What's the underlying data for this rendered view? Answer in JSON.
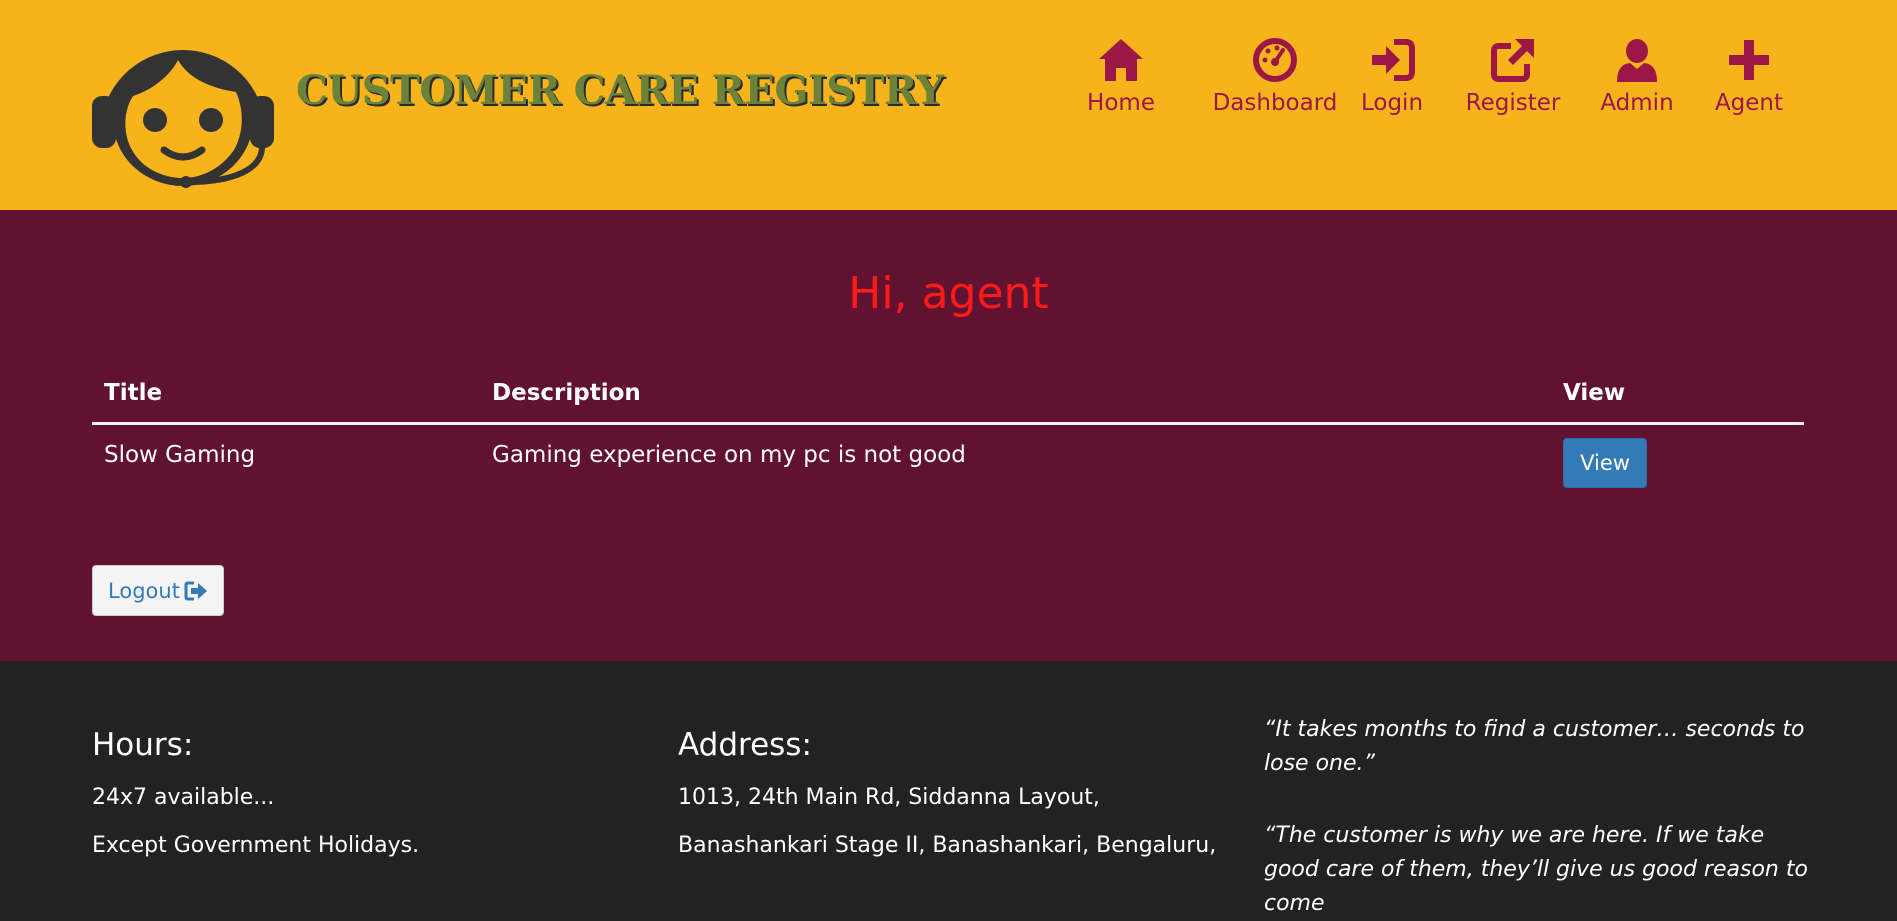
{
  "header": {
    "site_title": "CUSTOMER CARE REGISTRY",
    "logo_icon": "support-agent-headset-face-icon",
    "nav": [
      {
        "label": "Home",
        "icon": "home-icon"
      },
      {
        "label": "Dashboard",
        "icon": "dashboard-icon"
      },
      {
        "label": "Login",
        "icon": "login-icon"
      },
      {
        "label": "Register",
        "icon": "external-link-icon"
      },
      {
        "label": "Admin",
        "icon": "user-icon"
      },
      {
        "label": "Agent",
        "icon": "plus-icon"
      }
    ]
  },
  "main": {
    "greeting": "Hi, agent",
    "table": {
      "columns": [
        "Title",
        "Description",
        "View"
      ],
      "rows": [
        {
          "title": "Slow Gaming",
          "description": "Gaming experience on my pc is not good",
          "action_label": "View"
        }
      ]
    },
    "logout_label": "Logout"
  },
  "footer": {
    "hours": {
      "heading": "Hours:",
      "lines": [
        "24x7 available...",
        "Except Government Holidays."
      ]
    },
    "address": {
      "heading": "Address:",
      "lines": [
        "1013, 24th Main Rd, Siddanna Layout,",
        "Banashankari Stage II, Banashankari, Bengaluru,"
      ]
    },
    "quotes": [
      "“It takes months to find a customer… seconds to lose one.”",
      "“The customer is why we are here. If we take good care of them, they’ll give us good reason to come"
    ]
  },
  "colors": {
    "header_bg": "#f6b31b",
    "nav_accent": "#9c1646",
    "main_bg": "#601230",
    "greeting": "#ff1a1a",
    "footer_bg": "#222222",
    "primary_button": "#337ab7"
  }
}
